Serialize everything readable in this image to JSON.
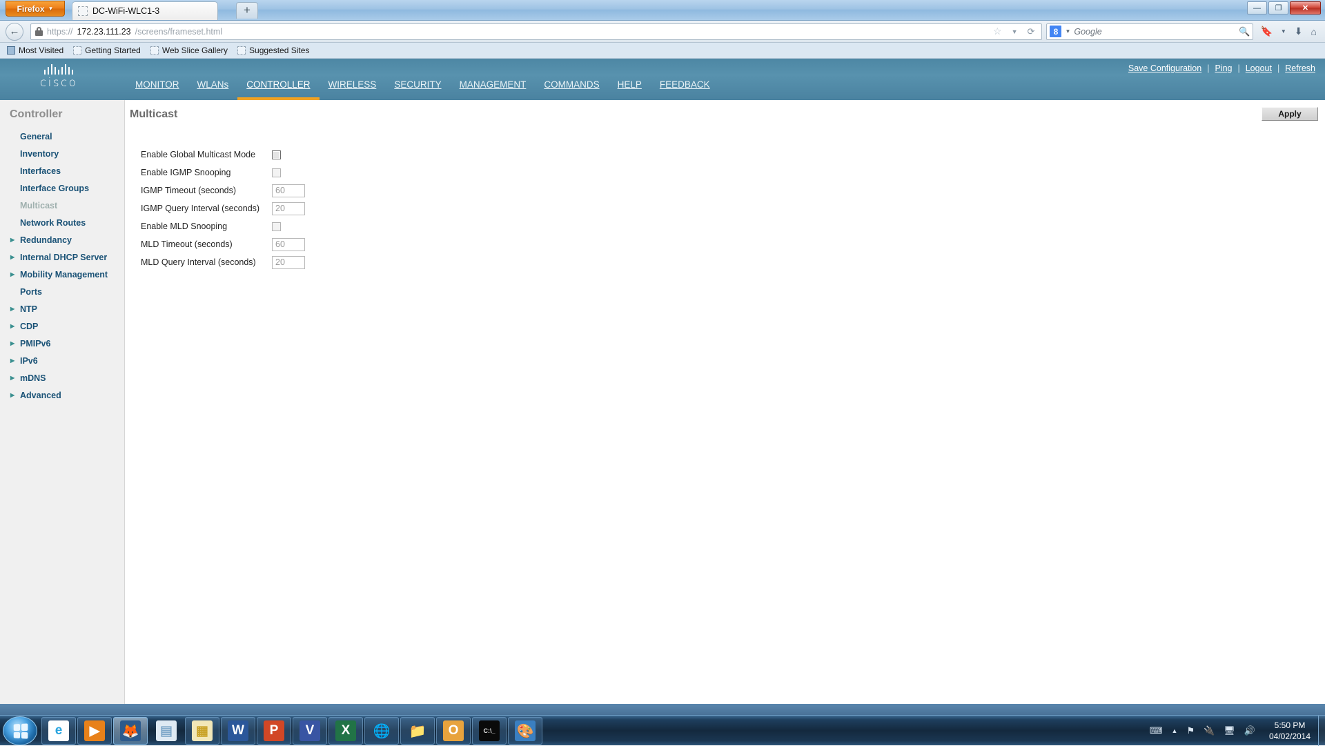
{
  "browser": {
    "firefox_button": "Firefox",
    "tab_title": "DC-WiFi-WLC1-3",
    "new_tab_label": "+",
    "url_protocol": "https://",
    "url_host": "172.23.111.23",
    "url_path": "/screens/frameset.html",
    "search_engine": "Google",
    "search_badge": "8",
    "window_minimize": "—",
    "window_restore": "❐",
    "window_close": "✕",
    "bookmarks": [
      {
        "label": "Most Visited"
      },
      {
        "label": "Getting Started"
      },
      {
        "label": "Web Slice Gallery"
      },
      {
        "label": "Suggested Sites"
      }
    ]
  },
  "cisco": {
    "brand": "cisco",
    "top_links": [
      {
        "label": "Save Configuration"
      },
      {
        "label": "Ping"
      },
      {
        "label": "Logout"
      },
      {
        "label": "Refresh"
      }
    ],
    "separator": "|",
    "main_nav": [
      {
        "label": "MONITOR",
        "active": false
      },
      {
        "label": "WLANs",
        "active": false
      },
      {
        "label": "CONTROLLER",
        "active": true
      },
      {
        "label": "WIRELESS",
        "active": false
      },
      {
        "label": "SECURITY",
        "active": false
      },
      {
        "label": "MANAGEMENT",
        "active": false
      },
      {
        "label": "COMMANDS",
        "active": false
      },
      {
        "label": "HELP",
        "active": false
      },
      {
        "label": "FEEDBACK",
        "active": false
      }
    ],
    "accent_color": "#f0a223",
    "header_color": "#4d87a4"
  },
  "sidebar": {
    "title": "Controller",
    "items": [
      {
        "label": "General",
        "expandable": false,
        "current": false
      },
      {
        "label": "Inventory",
        "expandable": false,
        "current": false
      },
      {
        "label": "Interfaces",
        "expandable": false,
        "current": false
      },
      {
        "label": "Interface Groups",
        "expandable": false,
        "current": false
      },
      {
        "label": "Multicast",
        "expandable": false,
        "current": true
      },
      {
        "label": "Network Routes",
        "expandable": false,
        "current": false
      },
      {
        "label": "Redundancy",
        "expandable": true,
        "current": false
      },
      {
        "label": "Internal DHCP Server",
        "expandable": true,
        "current": false
      },
      {
        "label": "Mobility Management",
        "expandable": true,
        "current": false
      },
      {
        "label": "Ports",
        "expandable": false,
        "current": false
      },
      {
        "label": "NTP",
        "expandable": true,
        "current": false
      },
      {
        "label": "CDP",
        "expandable": true,
        "current": false
      },
      {
        "label": "PMIPv6",
        "expandable": true,
        "current": false
      },
      {
        "label": "IPv6",
        "expandable": true,
        "current": false
      },
      {
        "label": "mDNS",
        "expandable": true,
        "current": false
      },
      {
        "label": "Advanced",
        "expandable": true,
        "current": false
      }
    ],
    "expand_arrow": "▶"
  },
  "main": {
    "page_title": "Multicast",
    "apply_label": "Apply",
    "fields": [
      {
        "label": "Enable Global Multicast Mode",
        "type": "checkbox",
        "checked": false,
        "focused": true
      },
      {
        "label": "Enable IGMP Snooping",
        "type": "checkbox",
        "checked": false,
        "focused": false
      },
      {
        "label": "IGMP Timeout (seconds)",
        "type": "text",
        "value": "60"
      },
      {
        "label": "IGMP Query Interval (seconds)",
        "type": "text",
        "value": "20"
      },
      {
        "label": "Enable MLD Snooping",
        "type": "checkbox",
        "checked": false,
        "focused": false
      },
      {
        "label": "MLD Timeout (seconds)",
        "type": "text",
        "value": "60"
      },
      {
        "label": "MLD Query Interval (seconds)",
        "type": "text",
        "value": "20"
      }
    ]
  },
  "taskbar": {
    "start_label": "Start",
    "apps": [
      {
        "name": "internet-explorer",
        "glyph": "e",
        "color": "#2aa5e0",
        "bg": "#ffffff",
        "active": false,
        "group": true
      },
      {
        "name": "media-player",
        "glyph": "▶",
        "color": "#ffffff",
        "bg": "#e8811a",
        "active": false,
        "group": true
      },
      {
        "name": "firefox",
        "glyph": "🦊",
        "color": "#e8811a",
        "bg": "#2c5a8c",
        "active": true,
        "group": false
      },
      {
        "name": "notepad",
        "glyph": "▤",
        "color": "#7fa8c9",
        "bg": "#dfeaf3",
        "active": false,
        "group": false
      },
      {
        "name": "sticky-notes",
        "glyph": "▦",
        "color": "#c9a227",
        "bg": "#f2e7b8",
        "active": false,
        "group": true
      },
      {
        "name": "word",
        "glyph": "W",
        "color": "#ffffff",
        "bg": "#2b579a",
        "active": false,
        "group": true
      },
      {
        "name": "powerpoint",
        "glyph": "P",
        "color": "#ffffff",
        "bg": "#d24726",
        "active": false,
        "group": true
      },
      {
        "name": "visio",
        "glyph": "V",
        "color": "#ffffff",
        "bg": "#3955a3",
        "active": false,
        "group": true
      },
      {
        "name": "excel",
        "glyph": "X",
        "color": "#ffffff",
        "bg": "#217346",
        "active": false,
        "group": true
      },
      {
        "name": "network-globe",
        "glyph": "🌐",
        "color": "#6aa8d8",
        "bg": "transparent",
        "active": false,
        "group": true
      },
      {
        "name": "folder",
        "glyph": "📁",
        "color": "#e3b23c",
        "bg": "transparent",
        "active": false,
        "group": true
      },
      {
        "name": "outlook",
        "glyph": "O",
        "color": "#ffffff",
        "bg": "#e8a33d",
        "active": false,
        "group": true
      },
      {
        "name": "command-prompt",
        "glyph": "C:\\_",
        "color": "#e8e8e8",
        "bg": "#0a0a0a",
        "active": false,
        "group": true
      },
      {
        "name": "paint",
        "glyph": "🎨",
        "color": "#ffffff",
        "bg": "#3a7fc1",
        "active": false,
        "group": true
      }
    ],
    "tray_icons": [
      {
        "name": "keyboard-icon",
        "glyph": "⌨"
      },
      {
        "name": "show-hidden-icons",
        "glyph": "▲"
      },
      {
        "name": "action-flag-icon",
        "glyph": "⚑"
      },
      {
        "name": "power-plug-icon",
        "glyph": "🔌"
      },
      {
        "name": "network-icon",
        "glyph": "🖥"
      },
      {
        "name": "volume-icon",
        "glyph": "🔊"
      }
    ],
    "clock_time": "5:50 PM",
    "clock_date": "04/02/2014"
  }
}
